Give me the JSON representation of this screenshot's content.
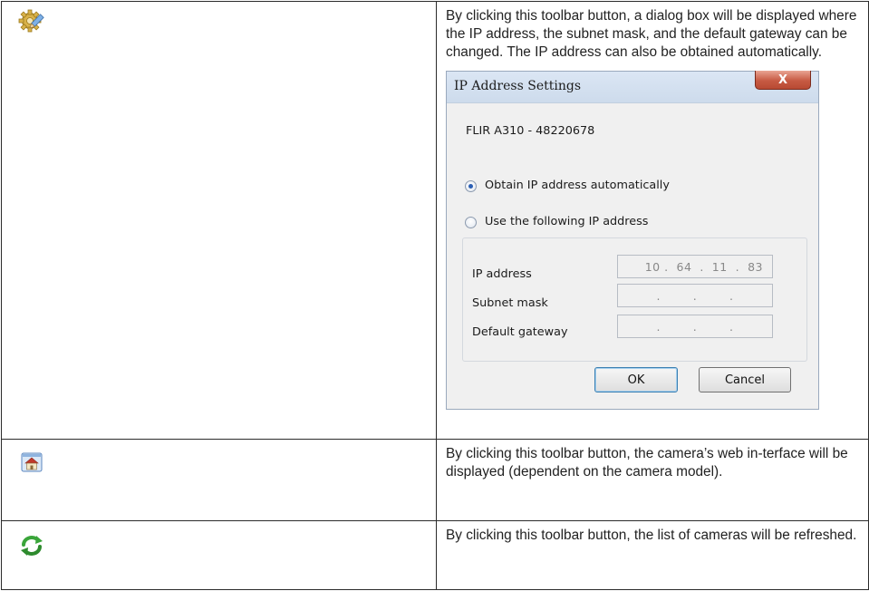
{
  "rows": [
    {
      "icon": "settings-gear-pencil-icon",
      "description": "By clicking this toolbar button, a dialog box will be displayed where the IP address, the subnet mask, and the default gateway can be changed. The IP address can also be obtained automatically."
    },
    {
      "icon": "web-interface-home-icon",
      "description": "By clicking this toolbar button, the camera’s web in-terface will be displayed (dependent on the camera model)."
    },
    {
      "icon": "refresh-arrows-icon",
      "description": "By clicking this toolbar button, the list of cameras will be refreshed."
    }
  ],
  "dialog": {
    "title": "IP Address Settings",
    "close_label": "X",
    "camera_name": "FLIR A310 - 48220678",
    "radio_auto_label": "Obtain IP address automatically",
    "radio_auto_checked": true,
    "radio_manual_label": "Use the following IP address",
    "radio_manual_checked": false,
    "fields": {
      "ip_label": "IP address",
      "ip_value": "10 .  64  .  11  .  83",
      "subnet_label": "Subnet mask",
      "subnet_value": ".        .        .",
      "gateway_label": "Default gateway",
      "gateway_value": ".        .        ."
    },
    "ok_label": "OK",
    "cancel_label": "Cancel"
  },
  "colors": {
    "dialog_background": "#f0f0f0",
    "close_button": "#c75a43",
    "radio_selected": "#2b5fb4",
    "refresh_icon": "#3aa53a"
  }
}
